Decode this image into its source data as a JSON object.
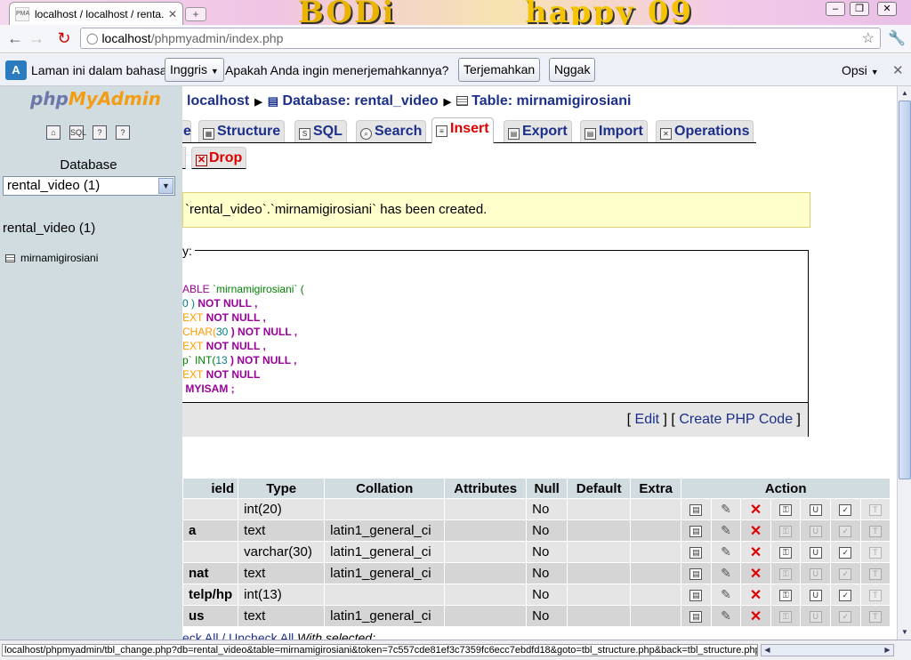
{
  "browser": {
    "tab_title": "localhost / localhost / renta...",
    "favicon_text": "PMA",
    "url_host": "localhost",
    "url_path": "/phpmyadmin/index.php",
    "status_url": "localhost/phpmyadmin/tbl_change.php?db=rental_video&table=mirnamigirosiani&token=7c557cde81ef3c7359fc6ecc7ebdfd18&goto=tbl_structure.php&back=tbl_structure.php"
  },
  "infobar": {
    "text_before": "Laman ini dalam bahasa",
    "language": "Inggris",
    "question": "Apakah Anda ingin menerjemahkannya?",
    "translate_button": "Terjemahkan",
    "no_button": "Nggak",
    "options": "Opsi"
  },
  "sidebar": {
    "logo_php": "php",
    "logo_my": "MyAdmin",
    "db_label": "Database",
    "db_selected": "rental_video (1)",
    "db_name": "rental_video (1)",
    "tables": [
      "mirnamigirosiani"
    ]
  },
  "breadcrumb": {
    "server": "localhost",
    "database": "Database: rental_video",
    "table": "Table: mirnamigirosiani"
  },
  "tabs": {
    "browse_partial": "e",
    "structure": "Structure",
    "sql": "SQL",
    "search": "Search",
    "insert": "Insert",
    "export": "Export",
    "import": "Import",
    "operations": "Operations",
    "drop": "Drop"
  },
  "notice": "`rental_video`.`mirnamigirosiani` has been created.",
  "sql_box": {
    "legend_partial": "y:",
    "lines": [
      {
        "a": "ABLE",
        "b": " `mirnamigirosiani` ("
      },
      {
        "a": "0 )",
        "b": " NOT NULL ,"
      },
      {
        "a": "EXT",
        "b": " NOT NULL ,"
      },
      {
        "a": "CHAR(",
        "n": "30",
        "c": " ) NOT NULL ,"
      },
      {
        "a": "EXT",
        "b": " NOT NULL ,"
      },
      {
        "a": "p` INT(",
        "n": "13",
        "c": " ) NOT NULL ,"
      },
      {
        "a": "EXT",
        "b": " NOT NULL"
      },
      {
        "a": "",
        "b": "MYISAM ;"
      }
    ],
    "edit_link": "Edit",
    "php_link": "Create PHP Code"
  },
  "structure_table": {
    "headers": [
      "ield",
      "Type",
      "Collation",
      "Attributes",
      "Null",
      "Default",
      "Extra",
      "Action"
    ],
    "rows": [
      {
        "field": "",
        "type": "int(20)",
        "collation": "",
        "attributes": "",
        "null": "No",
        "default": "",
        "extra": ""
      },
      {
        "field": "a",
        "type": "text",
        "collation": "latin1_general_ci",
        "attributes": "",
        "null": "No",
        "default": "",
        "extra": ""
      },
      {
        "field": "",
        "type": "varchar(30)",
        "collation": "latin1_general_ci",
        "attributes": "",
        "null": "No",
        "default": "",
        "extra": ""
      },
      {
        "field": "nat",
        "type": "text",
        "collation": "latin1_general_ci",
        "attributes": "",
        "null": "No",
        "default": "",
        "extra": ""
      },
      {
        "field": "telp/hp",
        "type": "int(13)",
        "collation": "",
        "attributes": "",
        "null": "No",
        "default": "",
        "extra": ""
      },
      {
        "field": "us",
        "type": "text",
        "collation": "latin1_general_ci",
        "attributes": "",
        "null": "No",
        "default": "",
        "extra": ""
      }
    ]
  },
  "bottom": {
    "check_all": "eck All",
    "sep": " / ",
    "uncheck_all": "Uncheck All",
    "with_selected": " With selected:"
  }
}
